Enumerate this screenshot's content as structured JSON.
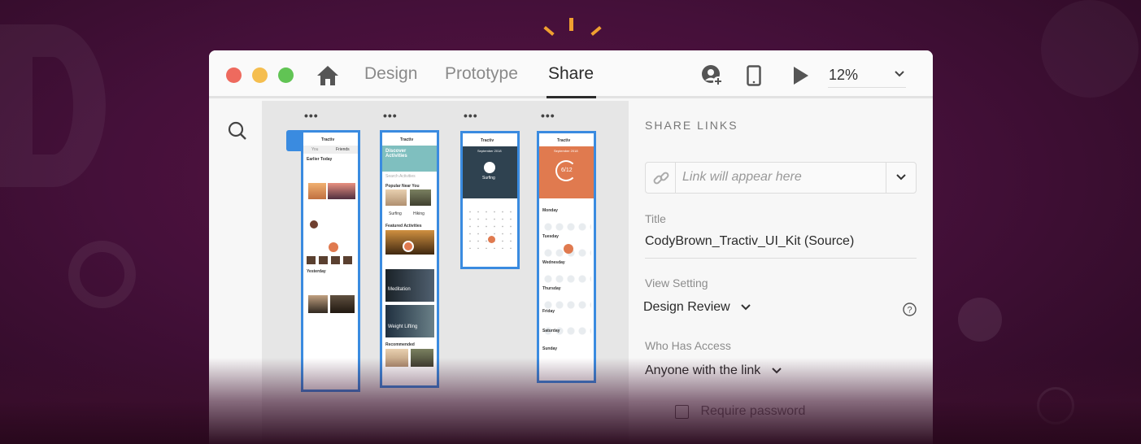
{
  "toolbar": {
    "tabs": [
      {
        "label": "Design"
      },
      {
        "label": "Prototype"
      },
      {
        "label": "Share"
      }
    ],
    "active_tab": "Share",
    "zoom": "12%"
  },
  "artboards": {
    "app_name": "Tractiv",
    "feed": {
      "tab_you": "You",
      "tab_friends": "Friends",
      "section": "Earlier Today",
      "section2": "Yesterday"
    },
    "discover": {
      "title": "Discover Activities",
      "search_placeholder": "Search Activities",
      "popular": "Popular Near You",
      "featured": "Featured Activities",
      "meditation": "Meditation",
      "weight": "Weight Lifting",
      "recommended": "Recommended",
      "card1": "Surfing",
      "card2": "Hiking"
    },
    "calendar": {
      "month": "September 2018",
      "activity": "Surfing"
    },
    "progress": {
      "month": "September 2018",
      "count": "6/12",
      "day1": "Monday",
      "day2": "Tuesday",
      "day3": "Wednesday",
      "day4": "Thursday",
      "day5": "Friday",
      "day6": "Saturday",
      "day7": "Sunday"
    }
  },
  "share": {
    "heading": "SHARE LINKS",
    "link_placeholder": "Link will appear here",
    "title_label": "Title",
    "title_value": "CodyBrown_Tractiv_UI_Kit (Source)",
    "view_setting_label": "View Setting",
    "view_setting_value": "Design Review",
    "access_label": "Who Has Access",
    "access_value": "Anyone with the link",
    "require_password": "Require password"
  },
  "colors": {
    "accent": "#3a8be0",
    "brand": "#e07a4f",
    "teal": "#7fbfbf",
    "navy": "#2f4250"
  }
}
